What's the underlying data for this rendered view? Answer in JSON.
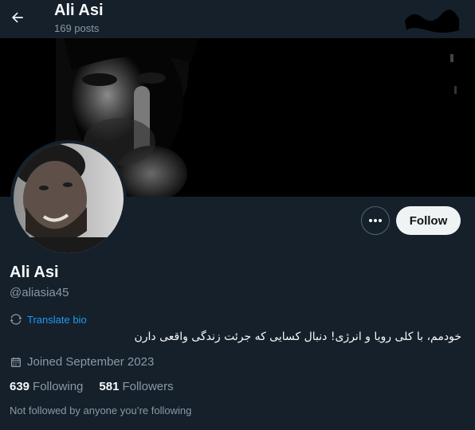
{
  "header": {
    "name": "Ali Asi",
    "posts": "169 posts"
  },
  "actions": {
    "follow_label": "Follow"
  },
  "profile": {
    "display_name": "Ali Asi",
    "handle": "@aliasia45",
    "translate_label": "Translate bio",
    "bio": "خودمم، با کلی رویا و انرژی! دنبال کسایی که جرئت زندگی واقعی دارن",
    "joined": "Joined September 2023",
    "following_count": "639",
    "following_label": "Following",
    "followers_count": "581",
    "followers_label": "Followers",
    "not_followed": "Not followed by anyone you’re following"
  },
  "icons": {
    "back": "arrow-left-icon",
    "more": "more-horizontal-icon",
    "translate": "translate-icon",
    "calendar": "calendar-icon"
  },
  "colors": {
    "background": "#15202b",
    "accent": "#1d9bf0",
    "secondary_text": "#8b98a5",
    "follow_button": "#eff3f4"
  }
}
